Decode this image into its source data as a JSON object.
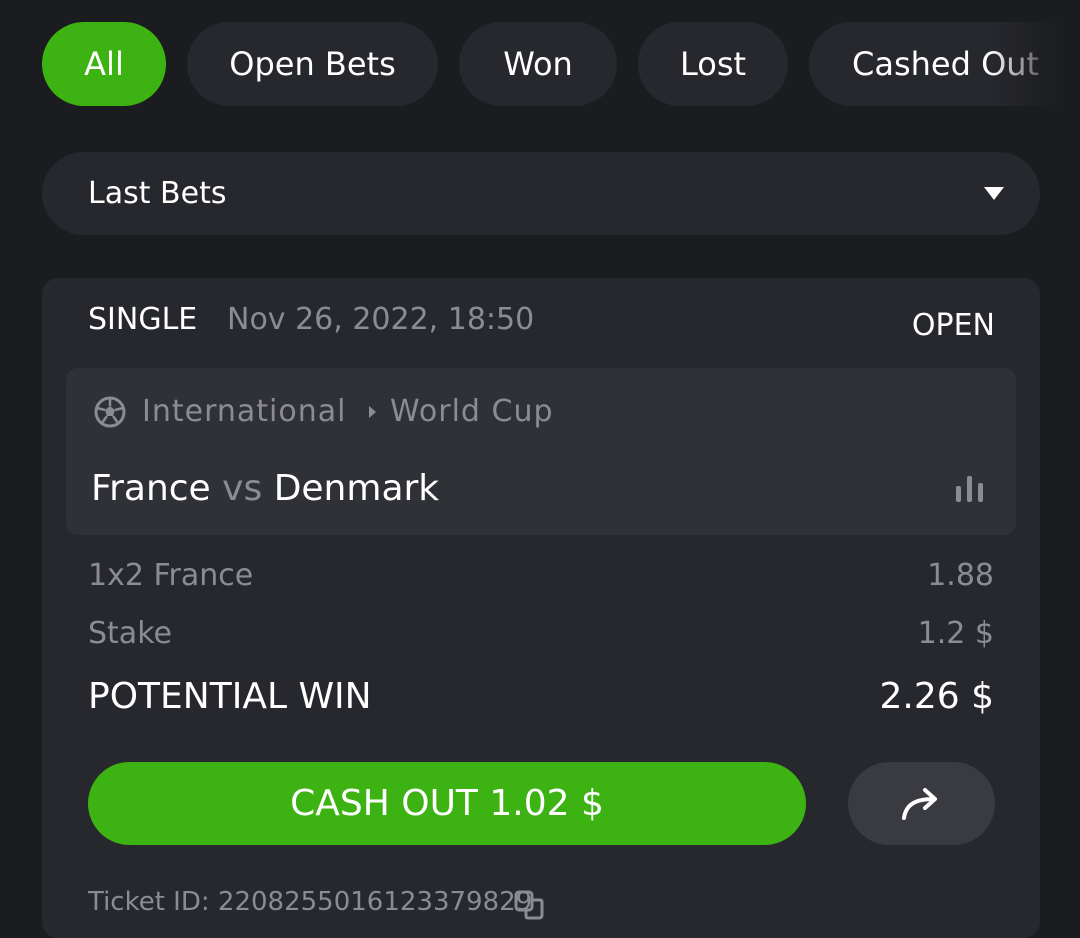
{
  "filters": {
    "all": "All",
    "open_bets": "Open Bets",
    "won": "Won",
    "lost": "Lost",
    "cashed_out": "Cashed Out"
  },
  "dropdown": {
    "selected": "Last Bets"
  },
  "bet": {
    "type": "SINGLE",
    "date": "Nov 26, 2022, 18:50",
    "status": "OPEN",
    "league": "International",
    "competition": "World Cup",
    "home": "France",
    "vs": "vs",
    "away": "Denmark",
    "market_label": "1x2 France",
    "odds": "1.88",
    "stake_label": "Stake",
    "stake": "1.2 $",
    "potential_win_label": "POTENTIAL WIN",
    "potential_win": "2.26 $",
    "cashout_label": "CASH OUT 1.02 $",
    "ticket": "Ticket ID: 2208255016123379829"
  },
  "colors": {
    "accent": "#3db213",
    "background": "#1b1c20",
    "card": "#27282d",
    "muted": "#8b8c91"
  }
}
